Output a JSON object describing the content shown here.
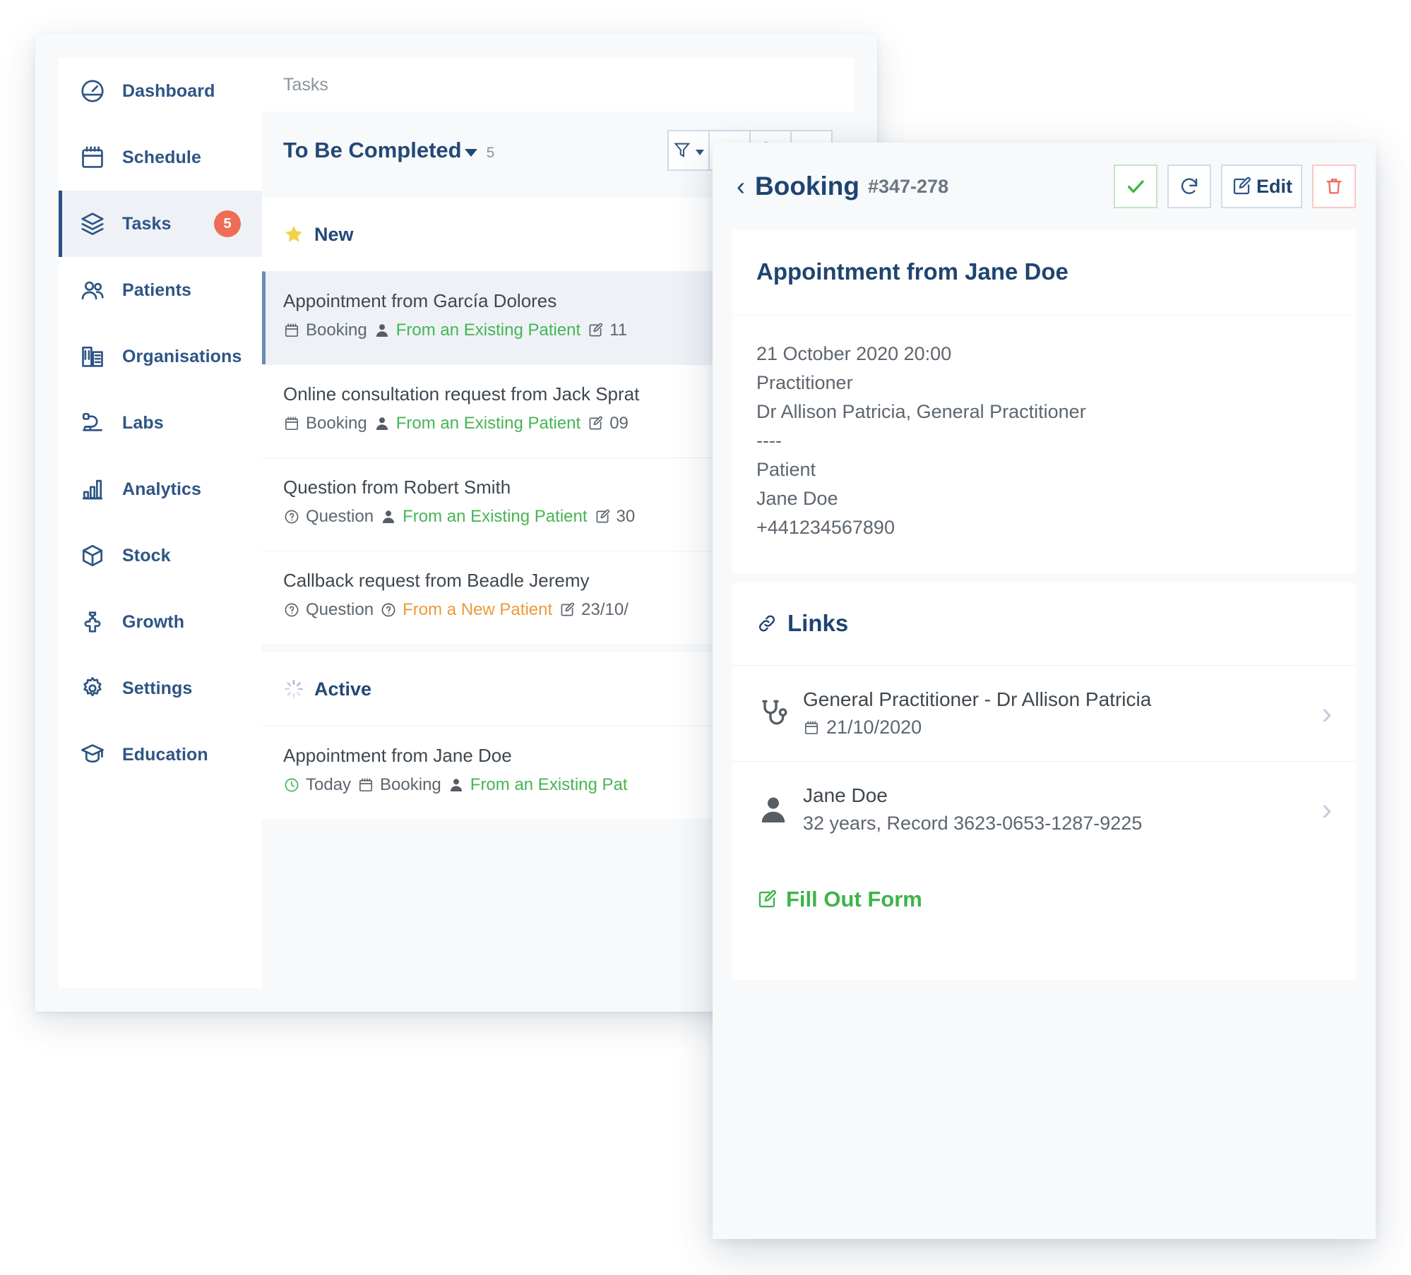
{
  "sidebar": {
    "items": [
      {
        "label": "Dashboard",
        "icon": "dashboard-icon",
        "active": false,
        "badge": ""
      },
      {
        "label": "Schedule",
        "icon": "calendar-icon",
        "active": false,
        "badge": ""
      },
      {
        "label": "Tasks",
        "icon": "layers-icon",
        "active": true,
        "badge": "5"
      },
      {
        "label": "Patients",
        "icon": "users-icon",
        "active": false,
        "badge": ""
      },
      {
        "label": "Organisations",
        "icon": "building-icon",
        "active": false,
        "badge": ""
      },
      {
        "label": "Labs",
        "icon": "microscope-icon",
        "active": false,
        "badge": ""
      },
      {
        "label": "Analytics",
        "icon": "bar-chart-icon",
        "active": false,
        "badge": ""
      },
      {
        "label": "Stock",
        "icon": "box-icon",
        "active": false,
        "badge": ""
      },
      {
        "label": "Growth",
        "icon": "puzzle-icon",
        "active": false,
        "badge": ""
      },
      {
        "label": "Settings",
        "icon": "gear-icon",
        "active": false,
        "badge": ""
      },
      {
        "label": "Education",
        "icon": "graduation-cap-icon",
        "active": false,
        "badge": ""
      }
    ]
  },
  "tasks": {
    "search_placeholder": "Tasks",
    "header": {
      "title": "To Be Completed",
      "count": "5",
      "buttons": [
        {
          "name": "filter-button",
          "icon": "filter-icon"
        },
        {
          "name": "refresh-button",
          "icon": "refresh-icon"
        },
        {
          "name": "call-button",
          "icon": "phone-icon"
        },
        {
          "name": "add-button",
          "icon": "plus-icon"
        }
      ]
    },
    "groups": [
      {
        "label": "New",
        "icon": "star-icon",
        "icon_color": "#f0d24b",
        "rows": [
          {
            "title": "Appointment from García Dolores",
            "selected": true,
            "type_label": "Booking",
            "type_icon": "calendar-icon",
            "source_label": "From an Existing Patient",
            "source_icon": "person-icon",
            "source_color": "green",
            "date_label": "11",
            "date_icon": "edit-icon",
            "today_label": ""
          },
          {
            "title": "Online consultation request from Jack Sprat",
            "selected": false,
            "type_label": "Booking",
            "type_icon": "calendar-icon",
            "source_label": "From an Existing Patient",
            "source_icon": "person-icon",
            "source_color": "green",
            "date_label": "09",
            "date_icon": "edit-icon",
            "today_label": ""
          },
          {
            "title": "Question from Robert Smith",
            "selected": false,
            "type_label": "Question",
            "type_icon": "question-circle-icon",
            "source_label": "From an Existing Patient",
            "source_icon": "person-icon",
            "source_color": "green",
            "date_label": "30",
            "date_icon": "edit-icon",
            "today_label": ""
          },
          {
            "title": "Callback request from Beadle Jeremy",
            "selected": false,
            "type_label": "Question",
            "type_icon": "question-circle-icon",
            "source_label": "From a New Patient",
            "source_icon": "question-circle-icon",
            "source_color": "orange",
            "date_label": "23/10/",
            "date_icon": "edit-icon",
            "today_label": ""
          }
        ]
      },
      {
        "label": "Active",
        "icon": "spinner-icon",
        "icon_color": "#b3a4e0",
        "rows": [
          {
            "title": "Appointment from Jane Doe",
            "selected": false,
            "type_label": "Booking",
            "type_icon": "calendar-icon",
            "source_label": "From an Existing Pat",
            "source_icon": "person-icon",
            "source_color": "green",
            "date_label": "",
            "date_icon": "",
            "today_label": "Today"
          }
        ]
      }
    ]
  },
  "detail": {
    "back_label": "‹",
    "title": "Booking",
    "id": "#347-278",
    "buttons": [
      {
        "name": "complete-button",
        "icon": "check-icon",
        "label": ""
      },
      {
        "name": "refresh-button",
        "icon": "refresh-icon",
        "label": ""
      },
      {
        "name": "edit-button",
        "icon": "edit-icon",
        "label": "Edit"
      },
      {
        "name": "delete-button",
        "icon": "trash-icon",
        "label": ""
      }
    ],
    "heading": "Appointment from Jane Doe",
    "body_lines": [
      "21 October 2020 20:00",
      "Practitioner",
      "Dr Allison Patricia, General Practitioner",
      "----",
      "Patient",
      "Jane Doe",
      "+441234567890"
    ],
    "links_title": "Links",
    "links": [
      {
        "icon": "stethoscope-icon",
        "primary": "General Practitioner - Dr Allison Patricia",
        "secondary": "21/10/2020",
        "secondary_icon": "calendar-icon"
      },
      {
        "icon": "person-icon",
        "primary": "Jane Doe",
        "secondary": "32 years, Record 3623-0653-1287-9225",
        "secondary_icon": ""
      }
    ],
    "fill_out_form_label": "Fill Out Form"
  },
  "colors": {
    "brand_navy": "#2e5585",
    "accent_green": "#46b555",
    "accent_orange": "#eb9b3a",
    "badge_red": "#ef6c56",
    "panel_bg": "#f7f9fb",
    "selected_bg": "#eef2f7"
  }
}
